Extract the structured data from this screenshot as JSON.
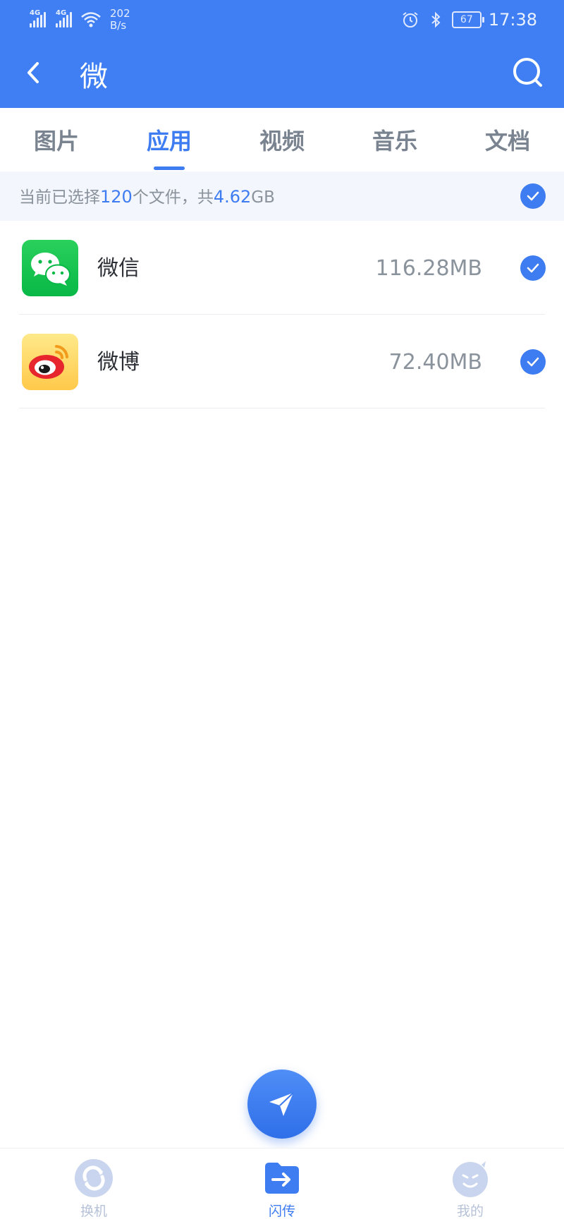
{
  "status_bar": {
    "signal_1_tag": "4G",
    "signal_2_tag": "4G",
    "net_speed_value": "202",
    "net_speed_unit": "B/s",
    "battery": "67",
    "time": "17:38",
    "icons": [
      "signal-icon",
      "wifi-icon",
      "alarm-icon",
      "bluetooth-icon",
      "battery-icon"
    ]
  },
  "header": {
    "title": "微",
    "background_color": "#3f7ff3"
  },
  "tabs": [
    {
      "label": "图片",
      "active": false
    },
    {
      "label": "应用",
      "active": true
    },
    {
      "label": "视频",
      "active": false
    },
    {
      "label": "音乐",
      "active": false
    },
    {
      "label": "文档",
      "active": false
    }
  ],
  "selection_summary": {
    "prefix": "当前已选择",
    "count": "120",
    "middle": "个文件，共",
    "size_value": "4.62",
    "size_unit": "GB",
    "all_selected": true
  },
  "apps": [
    {
      "name": "微信",
      "size": "116.28MB",
      "icon": "wechat-icon",
      "selected": true
    },
    {
      "name": "微博",
      "size": "72.40MB",
      "icon": "weibo-icon",
      "selected": true
    }
  ],
  "bottom_nav": [
    {
      "label": "换机",
      "icon": "switch-phone-icon",
      "active": false
    },
    {
      "label": "闪传",
      "icon": "flash-transfer-icon",
      "active": true
    },
    {
      "label": "我的",
      "icon": "profile-icon",
      "active": false
    }
  ],
  "accent_color": "#3e7cf1"
}
